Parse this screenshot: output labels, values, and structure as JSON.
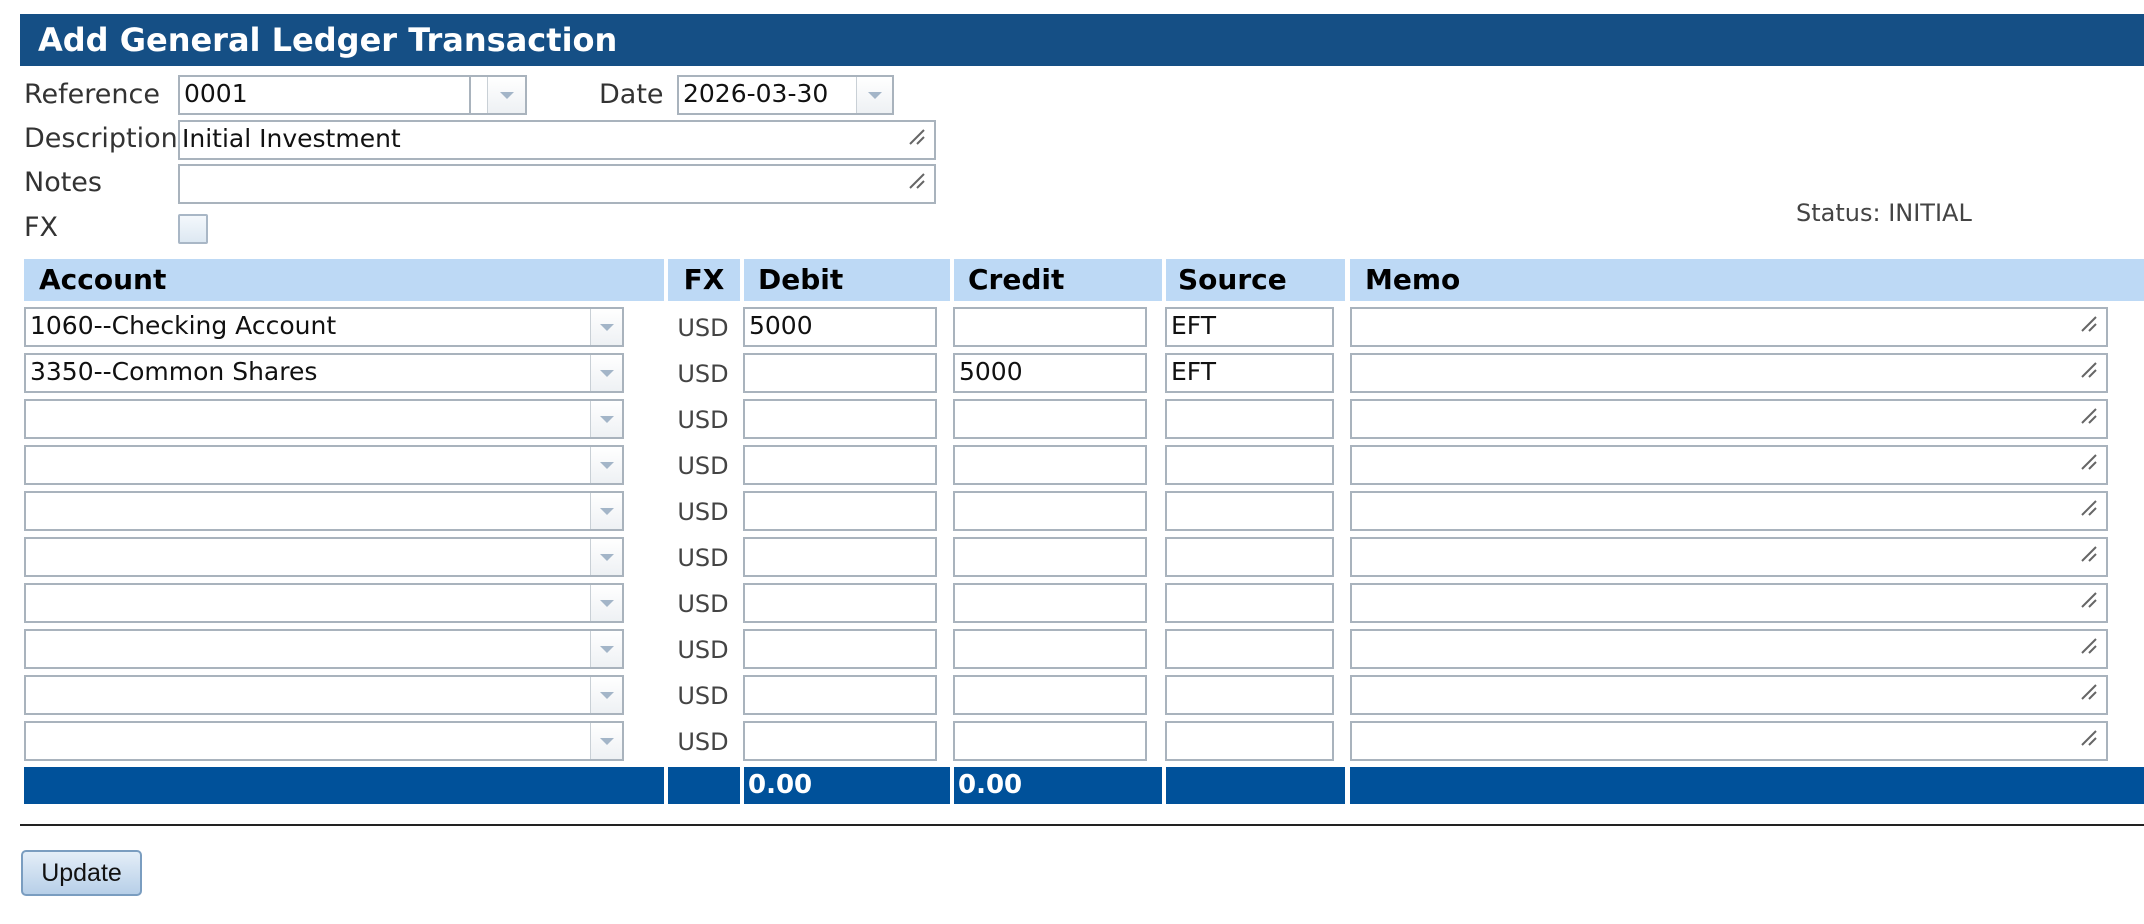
{
  "window_title": "Add General Ledger Transaction",
  "form": {
    "reference_label": "Reference",
    "reference_value": "0001",
    "date_label": "Date",
    "date_value": "2026-03-30",
    "description_label": "Description",
    "description_value": "Initial Investment",
    "notes_label": "Notes",
    "notes_value": "",
    "fx_label": "FX",
    "fx_checked": false,
    "status_text": "Status: INITIAL"
  },
  "table": {
    "headers": {
      "account": "Account",
      "fx": "FX",
      "debit": "Debit",
      "credit": "Credit",
      "source": "Source",
      "memo": "Memo"
    },
    "rows": [
      {
        "account": "1060--Checking Account",
        "fx": "USD",
        "debit": "5000",
        "credit": "",
        "source": "EFT",
        "memo": ""
      },
      {
        "account": "3350--Common Shares",
        "fx": "USD",
        "debit": "",
        "credit": "5000",
        "source": "EFT",
        "memo": ""
      },
      {
        "account": "",
        "fx": "USD",
        "debit": "",
        "credit": "",
        "source": "",
        "memo": ""
      },
      {
        "account": "",
        "fx": "USD",
        "debit": "",
        "credit": "",
        "source": "",
        "memo": ""
      },
      {
        "account": "",
        "fx": "USD",
        "debit": "",
        "credit": "",
        "source": "",
        "memo": ""
      },
      {
        "account": "",
        "fx": "USD",
        "debit": "",
        "credit": "",
        "source": "",
        "memo": ""
      },
      {
        "account": "",
        "fx": "USD",
        "debit": "",
        "credit": "",
        "source": "",
        "memo": ""
      },
      {
        "account": "",
        "fx": "USD",
        "debit": "",
        "credit": "",
        "source": "",
        "memo": ""
      },
      {
        "account": "",
        "fx": "USD",
        "debit": "",
        "credit": "",
        "source": "",
        "memo": ""
      },
      {
        "account": "",
        "fx": "USD",
        "debit": "",
        "credit": "",
        "source": "",
        "memo": ""
      }
    ],
    "totals": {
      "debit": "0.00",
      "credit": "0.00"
    }
  },
  "actions": {
    "update_label": "Update"
  },
  "colors": {
    "title_bar": "#154f85",
    "header_row": "#bdd9f5",
    "totals_row": "#00519a"
  }
}
